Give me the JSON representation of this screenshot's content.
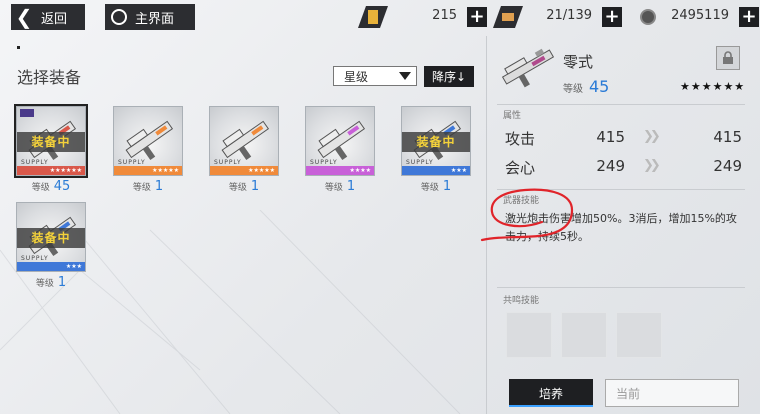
{
  "topbar": {
    "back_label": "返回",
    "home_label": "主界面",
    "resources": [
      {
        "icon": "coupon-icon",
        "value": "215"
      },
      {
        "icon": "battery-icon",
        "value": "21/139"
      },
      {
        "icon": "coin-icon",
        "value": "2495119"
      }
    ]
  },
  "left": {
    "title": "选择装备",
    "sort_value": "星级",
    "sort_order_label": "降序↓",
    "level_label": "等级",
    "equipped_label": "装备中",
    "supply_text": "SUPPLY",
    "items": [
      {
        "level": "45",
        "equipped": true,
        "stars": "★★★★★★",
        "rarity_color": "#d9584a",
        "selected": true
      },
      {
        "level": "1",
        "equipped": false,
        "stars": "★★★★★",
        "rarity_color": "#f08a3a",
        "selected": false
      },
      {
        "level": "1",
        "equipped": false,
        "stars": "★★★★★",
        "rarity_color": "#f08a3a",
        "selected": false
      },
      {
        "level": "1",
        "equipped": false,
        "stars": "★★★★",
        "rarity_color": "#c860d8",
        "selected": false
      },
      {
        "level": "1",
        "equipped": true,
        "stars": "★★★",
        "rarity_color": "#3f78d8",
        "selected": false
      },
      {
        "level": "1",
        "equipped": true,
        "stars": "★★★",
        "rarity_color": "#3f78d8",
        "selected": false
      }
    ]
  },
  "right": {
    "name": "零式",
    "level_label": "等级",
    "level": "45",
    "stars": "★★★★★★",
    "attributes_label": "属性",
    "stats": [
      {
        "name": "攻击",
        "current": "415",
        "next": "415"
      },
      {
        "name": "会心",
        "current": "249",
        "next": "249"
      }
    ],
    "skill_label": "武器技能",
    "skill_text": "激光炮击伤害增加50%。3消后，增加15%的攻击力，持续5秒。",
    "resonance_label": "共鸣技能",
    "train_label": "培养",
    "current_label": "当前"
  }
}
